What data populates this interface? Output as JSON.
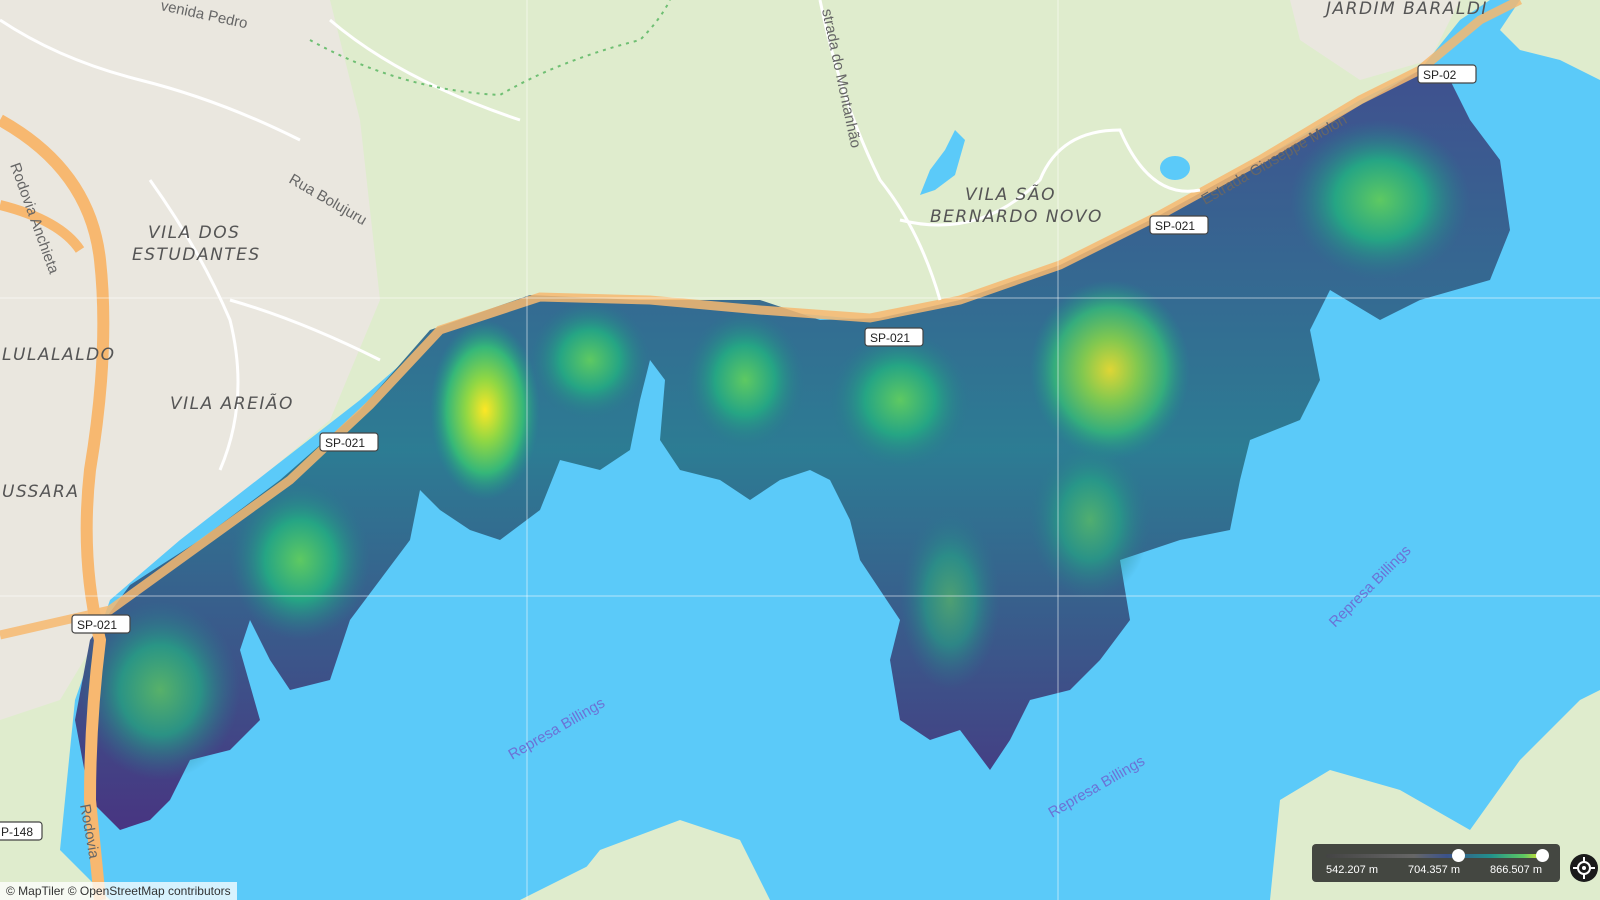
{
  "places": {
    "jardim_baraldi": "JARDIM BARALDI",
    "vila_dos_estudantes_1": "VILA DOS",
    "vila_dos_estudantes_2": "ESTUDANTES",
    "lulalaldo": "LULALALDO",
    "vila_areiao": "VILA AREIÃO",
    "ussara": "USSARA",
    "vila_sao_bernardo_1": "VILA SÃO",
    "vila_sao_bernardo_2": "BERNARDO NOVO"
  },
  "roads": {
    "avenida_pedro": "venida Pedro",
    "rua_bolujuru": "Rua Bolujuru",
    "rodovia_anchieta": "Rodovia Anchieta",
    "estrada_montanhao": "strada do Montanhão",
    "estrada_giuseppe": "Estrada Giuseppe Molon",
    "rodovia_bottom": "Rodovia"
  },
  "shields": {
    "sp021": "SP-021",
    "sp021_partial": "SP-02",
    "sp148": "P-148"
  },
  "water": {
    "billings": "Represa Billings"
  },
  "attribution": "© MapTiler  © OpenStreetMap contributors",
  "legend": {
    "min": "542.207 m",
    "mid": "704.357 m",
    "max": "866.507 m",
    "low_handle_fraction": 0.6,
    "high_handle_fraction": 1.0
  },
  "colors": {
    "water": "#5bcaf9",
    "land": "#dfeccd",
    "highway": "#f7b870",
    "viridis_low": "#46337e",
    "viridis_mid": "#21918c",
    "viridis_high": "#fde725"
  },
  "icons": {
    "locate": "locate-icon"
  }
}
